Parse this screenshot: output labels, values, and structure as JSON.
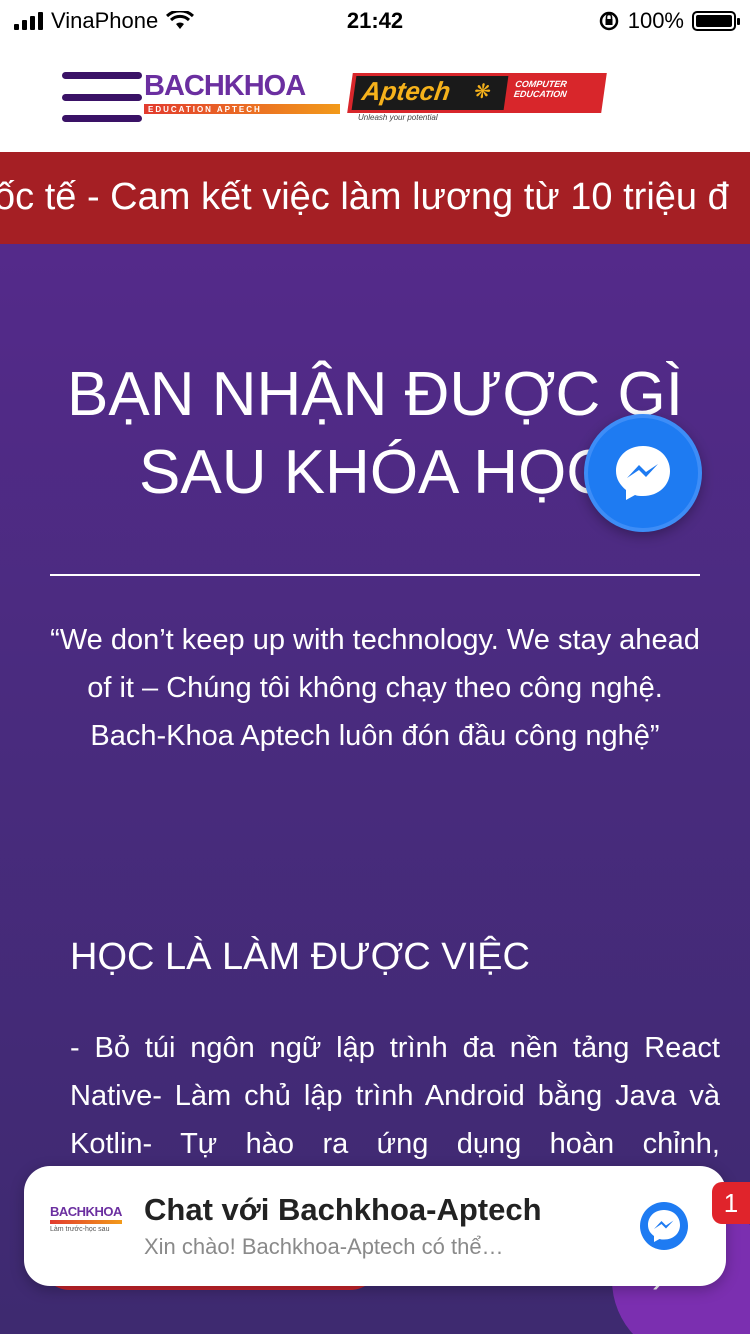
{
  "status_bar": {
    "carrier": "VinaPhone",
    "time": "21:42",
    "battery_percent": "100%",
    "battery_level": 1.0
  },
  "header": {
    "logo_bachkhoa_text": "BACHKHOA",
    "logo_bachkhoa_sub": "EDUCATION APTECH",
    "logo_aptech_text": "Aptech",
    "logo_aptech_side": "COMPUTER EDUCATION",
    "logo_aptech_tagline": "Unleash your potential"
  },
  "marquee": {
    "text": "ốc tế - Cam kết việc làm lương từ 10 triệu đ"
  },
  "main": {
    "title_line1": "BẠN NHẬN ĐƯỢC GÌ",
    "title_line2": "SAU KHÓA HỌC",
    "quote": "“We don’t keep up with technology. We stay ahead of it – Chúng tôi không chạy theo công nghệ. Bach-Khoa Aptech luôn đón đầu công nghệ”",
    "subheading": "HỌC LÀ LÀM ĐƯỢC VIỆC",
    "body": "- Bỏ túi ngôn ngữ lập trình đa nền tảng React Native- Làm chủ lập trình Android bằng Java và Kotlin- Tự hào ra ứng dụng hoàn chỉnh, 5000$/tháng- Đáp ứng nhu cầu của nghiệp với các ứng dụng IoT Service, bán và"
  },
  "chat_popup": {
    "title": "Chat với Bachkhoa-Aptech",
    "subtitle": "Xin chào! Bachkhoa-Aptech có thể…",
    "logo_text": "BACHKHOA",
    "logo_tagline": "Làm trước-học sau",
    "badge_count": "1"
  },
  "colors": {
    "purple_bg": "#4a2b7f",
    "marquee_red": "#a51f24",
    "messenger_blue": "#1e7bf2",
    "brand_purple": "#6b2fa0"
  },
  "icons": {
    "signal": "signal-icon",
    "wifi": "wifi-icon",
    "orientation_lock": "orientation-lock-icon",
    "battery": "battery-icon",
    "menu": "hamburger-menu-icon",
    "messenger": "messenger-icon"
  }
}
